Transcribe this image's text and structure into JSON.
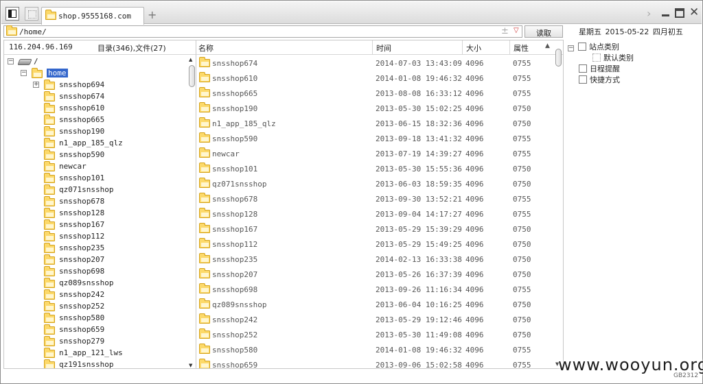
{
  "tab": {
    "title": "shop.9555168.com"
  },
  "address": {
    "path": "/home/",
    "read_label": "读取"
  },
  "date": {
    "text": "星期五 2015-05-22 四月初五"
  },
  "left": {
    "ip": "116.204.96.169",
    "counts": "目录(346),文件(27)",
    "tree": [
      {
        "label": "/",
        "depth": 0,
        "toggle": "−",
        "type": "drive"
      },
      {
        "label": "home",
        "depth": 1,
        "toggle": "−",
        "type": "folder",
        "selected": true
      },
      {
        "label": "snsshop694",
        "depth": 2,
        "toggle": "+",
        "type": "folder"
      },
      {
        "label": "snsshop674",
        "depth": 2,
        "type": "folder"
      },
      {
        "label": "snsshop610",
        "depth": 2,
        "type": "folder"
      },
      {
        "label": "snsshop665",
        "depth": 2,
        "type": "folder"
      },
      {
        "label": "snsshop190",
        "depth": 2,
        "type": "folder"
      },
      {
        "label": "n1_app_185_qlz",
        "depth": 2,
        "type": "folder"
      },
      {
        "label": "snsshop590",
        "depth": 2,
        "type": "folder"
      },
      {
        "label": "newcar",
        "depth": 2,
        "type": "folder"
      },
      {
        "label": "snsshop101",
        "depth": 2,
        "type": "folder"
      },
      {
        "label": "qz071snsshop",
        "depth": 2,
        "type": "folder"
      },
      {
        "label": "snsshop678",
        "depth": 2,
        "type": "folder"
      },
      {
        "label": "snsshop128",
        "depth": 2,
        "type": "folder"
      },
      {
        "label": "snsshop167",
        "depth": 2,
        "type": "folder"
      },
      {
        "label": "snsshop112",
        "depth": 2,
        "type": "folder"
      },
      {
        "label": "snsshop235",
        "depth": 2,
        "type": "folder"
      },
      {
        "label": "snsshop207",
        "depth": 2,
        "type": "folder"
      },
      {
        "label": "snsshop698",
        "depth": 2,
        "type": "folder"
      },
      {
        "label": "qz089snsshop",
        "depth": 2,
        "type": "folder"
      },
      {
        "label": "snsshop242",
        "depth": 2,
        "type": "folder"
      },
      {
        "label": "snsshop252",
        "depth": 2,
        "type": "folder"
      },
      {
        "label": "snsshop580",
        "depth": 2,
        "type": "folder"
      },
      {
        "label": "snsshop659",
        "depth": 2,
        "type": "folder"
      },
      {
        "label": "snsshop279",
        "depth": 2,
        "type": "folder"
      },
      {
        "label": "n1_app_121_lws",
        "depth": 2,
        "type": "folder"
      },
      {
        "label": "qz191snsshop",
        "depth": 2,
        "type": "folder"
      }
    ]
  },
  "list": {
    "columns": {
      "name": "名称",
      "time": "时间",
      "size": "大小",
      "attr": "属性"
    },
    "rows": [
      {
        "name": "snsshop674",
        "time": "2014-07-03 13:43:09",
        "size": "4096",
        "attr": "0755"
      },
      {
        "name": "snsshop610",
        "time": "2014-01-08 19:46:32",
        "size": "4096",
        "attr": "0755"
      },
      {
        "name": "snsshop665",
        "time": "2013-08-08 16:33:12",
        "size": "4096",
        "attr": "0755"
      },
      {
        "name": "snsshop190",
        "time": "2013-05-30 15:02:25",
        "size": "4096",
        "attr": "0750"
      },
      {
        "name": "n1_app_185_qlz",
        "time": "2013-06-15 18:32:36",
        "size": "4096",
        "attr": "0750"
      },
      {
        "name": "snsshop590",
        "time": "2013-09-18 13:41:32",
        "size": "4096",
        "attr": "0755"
      },
      {
        "name": "newcar",
        "time": "2013-07-19 14:39:27",
        "size": "4096",
        "attr": "0755"
      },
      {
        "name": "snsshop101",
        "time": "2013-05-30 15:55:36",
        "size": "4096",
        "attr": "0750"
      },
      {
        "name": "qz071snsshop",
        "time": "2013-06-03 18:59:35",
        "size": "4096",
        "attr": "0750"
      },
      {
        "name": "snsshop678",
        "time": "2013-09-30 13:52:21",
        "size": "4096",
        "attr": "0755"
      },
      {
        "name": "snsshop128",
        "time": "2013-09-04 14:17:27",
        "size": "4096",
        "attr": "0755"
      },
      {
        "name": "snsshop167",
        "time": "2013-05-29 15:39:29",
        "size": "4096",
        "attr": "0750"
      },
      {
        "name": "snsshop112",
        "time": "2013-05-29 15:49:25",
        "size": "4096",
        "attr": "0750"
      },
      {
        "name": "snsshop235",
        "time": "2014-02-13 16:33:38",
        "size": "4096",
        "attr": "0750"
      },
      {
        "name": "snsshop207",
        "time": "2013-05-26 16:37:39",
        "size": "4096",
        "attr": "0750"
      },
      {
        "name": "snsshop698",
        "time": "2013-09-26 11:16:34",
        "size": "4096",
        "attr": "0755"
      },
      {
        "name": "qz089snsshop",
        "time": "2013-06-04 10:16:25",
        "size": "4096",
        "attr": "0750"
      },
      {
        "name": "snsshop242",
        "time": "2013-05-29 19:12:46",
        "size": "4096",
        "attr": "0750"
      },
      {
        "name": "snsshop252",
        "time": "2013-05-30 11:49:08",
        "size": "4096",
        "attr": "0750"
      },
      {
        "name": "snsshop580",
        "time": "2014-01-08 19:46:32",
        "size": "4096",
        "attr": "0755"
      },
      {
        "name": "snsshop659",
        "time": "2013-09-06 15:02:58",
        "size": "4096",
        "attr": "0755"
      }
    ]
  },
  "right": {
    "items": [
      {
        "label": "站点类别",
        "icon": "collapse-box-icon",
        "indent": 0,
        "toggle": "−"
      },
      {
        "label": "默认类别",
        "icon": "category-icon",
        "indent": 1
      },
      {
        "label": "日程提醒",
        "icon": "schedule-icon",
        "indent": 0
      },
      {
        "label": "快捷方式",
        "icon": "shortcut-icon",
        "indent": 0
      }
    ]
  },
  "watermark": "www.wooyun.org",
  "encoding": "GB2312"
}
